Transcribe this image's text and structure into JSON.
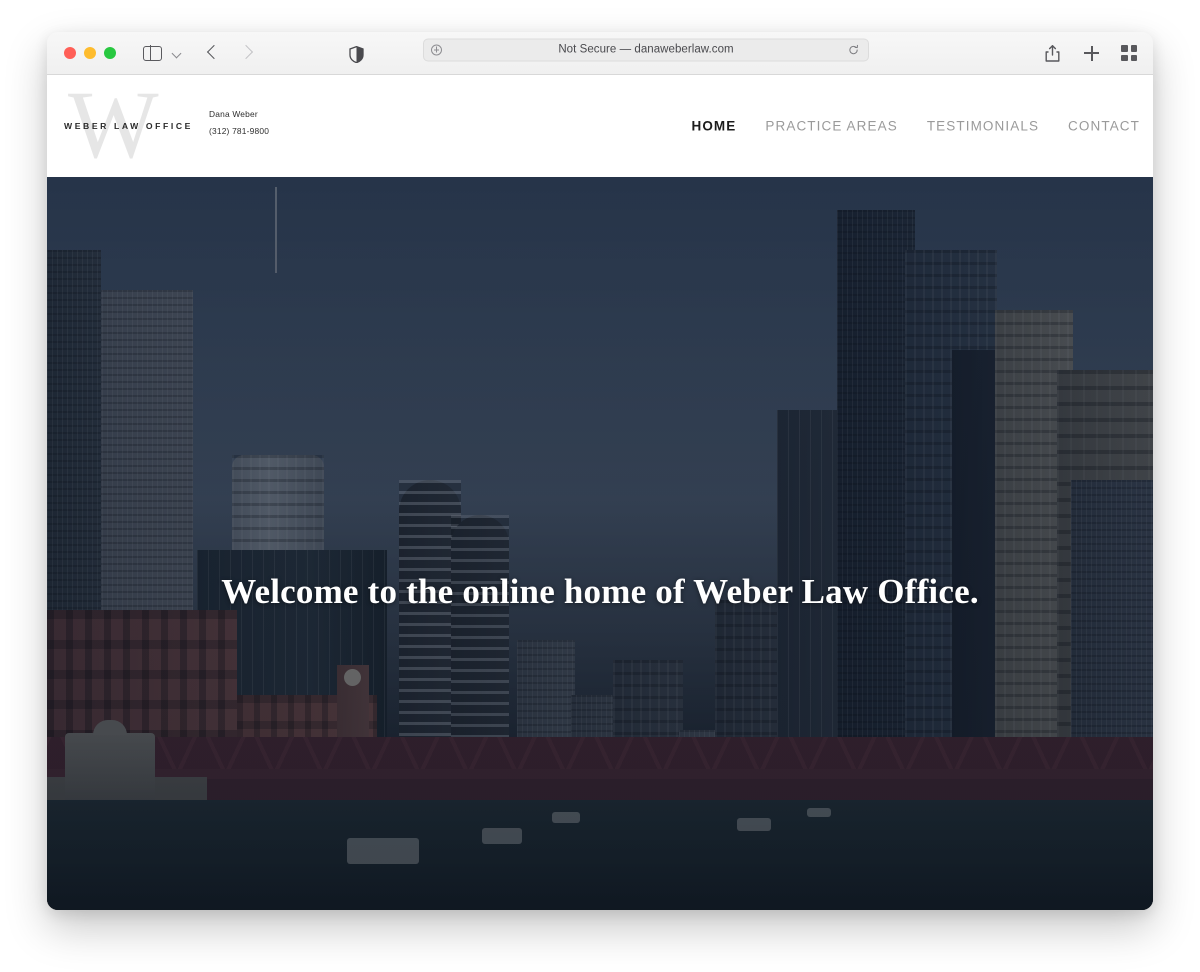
{
  "browser": {
    "traffic_lights": {
      "close_color": "#ff5f57",
      "minimize_color": "#febc2e",
      "zoom_color": "#28c840"
    },
    "url_text": "Not Secure — danaweberlaw.com",
    "icons": {
      "sidebar": "sidebar-icon",
      "tab_chevron": "chevron-down-icon",
      "back": "back-arrow-icon",
      "forward": "forward-arrow-icon",
      "privacy": "shield-icon",
      "page_settings": "page-settings-icon",
      "reload": "reload-icon",
      "share": "share-icon",
      "new_tab": "plus-icon",
      "tab_overview": "tab-overview-icon"
    }
  },
  "site": {
    "logo": {
      "monogram": "W",
      "wordmark": "WEBER LAW OFFICE"
    },
    "contact": {
      "name": "Dana Weber",
      "phone": "(312) 781-9800"
    },
    "nav": [
      {
        "label": "HOME",
        "active": true
      },
      {
        "label": "PRACTICE AREAS",
        "active": false
      },
      {
        "label": "TESTIMONIALS",
        "active": false
      },
      {
        "label": "CONTACT",
        "active": false
      }
    ],
    "hero": {
      "headline": "Welcome to the online home of Weber Law Office.",
      "image_description": "Chicago River skyline with Wells Street bridge",
      "overlay_color": "#101a2c"
    }
  }
}
